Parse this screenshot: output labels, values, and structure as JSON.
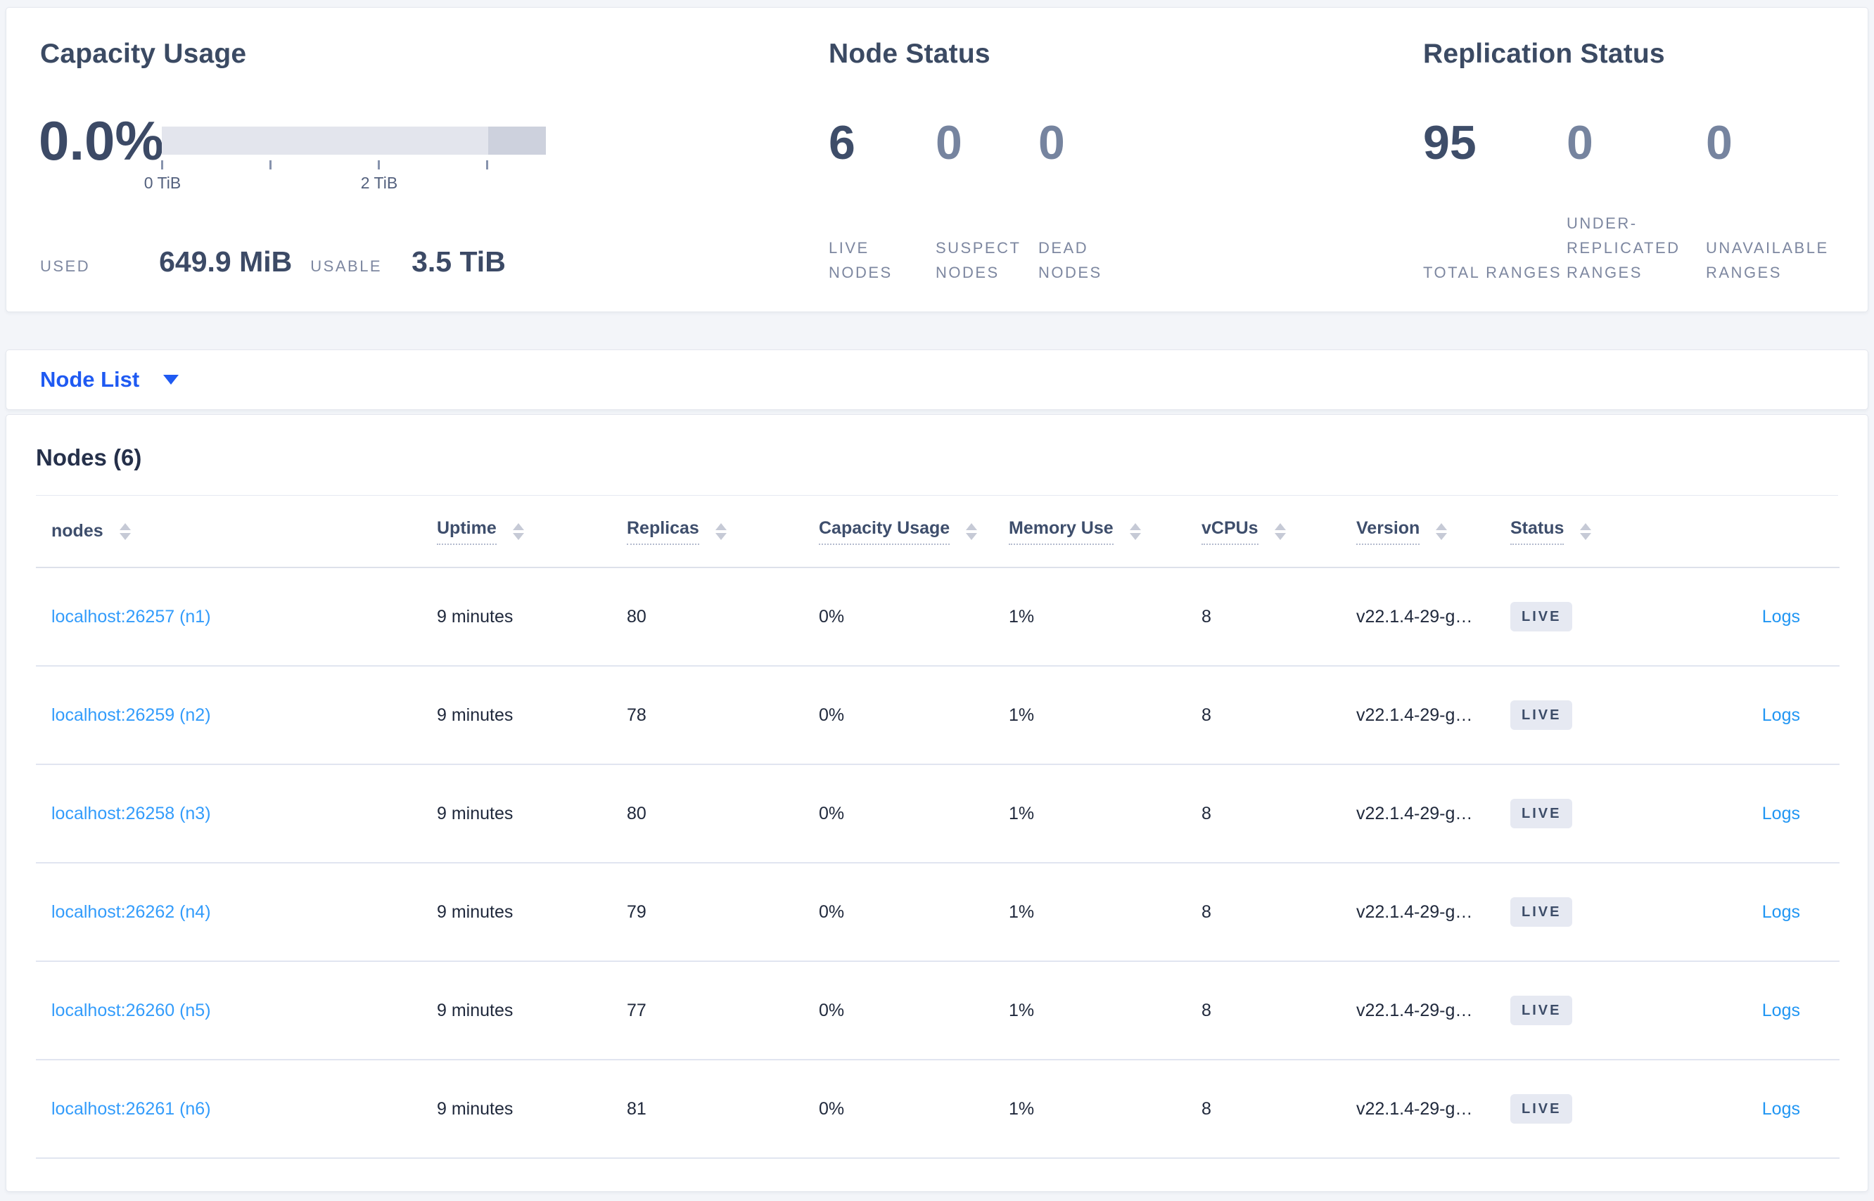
{
  "overview": {
    "capacity": {
      "title": "Capacity Usage",
      "percent": "0.0%",
      "axis_ticks": [
        "0 TiB",
        "2 TiB"
      ],
      "bar_dark_pct": 15,
      "used_label": "USED",
      "used_value": "649.9 MiB",
      "usable_label": "USABLE",
      "usable_value": "3.5 TiB"
    },
    "node_status": {
      "title": "Node Status",
      "stats": [
        {
          "value": "6",
          "label": "LIVE NODES"
        },
        {
          "value": "0",
          "label": "SUSPECT NODES"
        },
        {
          "value": "0",
          "label": "DEAD NODES"
        }
      ]
    },
    "replication_status": {
      "title": "Replication Status",
      "stats": [
        {
          "value": "95",
          "label": "TOTAL RANGES"
        },
        {
          "value": "0",
          "label": "UNDER-REPLICATED RANGES"
        },
        {
          "value": "0",
          "label": "UNAVAILABLE RANGES"
        }
      ]
    }
  },
  "view_selector": {
    "label": "Node List",
    "icon": "caret-down-icon"
  },
  "nodes_table": {
    "heading": "Nodes (6)",
    "columns": [
      {
        "label": "nodes"
      },
      {
        "label": "Uptime"
      },
      {
        "label": "Replicas"
      },
      {
        "label": "Capacity Usage"
      },
      {
        "label": "Memory Use"
      },
      {
        "label": "vCPUs"
      },
      {
        "label": "Version"
      },
      {
        "label": "Status"
      }
    ],
    "rows": [
      {
        "node": "localhost:26257 (n1)",
        "uptime": "9 minutes",
        "replicas": "80",
        "capacity": "0%",
        "memory": "1%",
        "vcpus": "8",
        "version": "v22.1.4-29-g…",
        "status": "LIVE",
        "logs": "Logs"
      },
      {
        "node": "localhost:26259 (n2)",
        "uptime": "9 minutes",
        "replicas": "78",
        "capacity": "0%",
        "memory": "1%",
        "vcpus": "8",
        "version": "v22.1.4-29-g…",
        "status": "LIVE",
        "logs": "Logs"
      },
      {
        "node": "localhost:26258 (n3)",
        "uptime": "9 minutes",
        "replicas": "80",
        "capacity": "0%",
        "memory": "1%",
        "vcpus": "8",
        "version": "v22.1.4-29-g…",
        "status": "LIVE",
        "logs": "Logs"
      },
      {
        "node": "localhost:26262 (n4)",
        "uptime": "9 minutes",
        "replicas": "79",
        "capacity": "0%",
        "memory": "1%",
        "vcpus": "8",
        "version": "v22.1.4-29-g…",
        "status": "LIVE",
        "logs": "Logs"
      },
      {
        "node": "localhost:26260 (n5)",
        "uptime": "9 minutes",
        "replicas": "77",
        "capacity": "0%",
        "memory": "1%",
        "vcpus": "8",
        "version": "v22.1.4-29-g…",
        "status": "LIVE",
        "logs": "Logs"
      },
      {
        "node": "localhost:26261 (n6)",
        "uptime": "9 minutes",
        "replicas": "81",
        "capacity": "0%",
        "memory": "1%",
        "vcpus": "8",
        "version": "v22.1.4-29-g…",
        "status": "LIVE",
        "logs": "Logs"
      }
    ]
  },
  "colors": {
    "page_bg": "#f3f5f9",
    "card_bg": "#ffffff",
    "accent_blue": "#1f5af2",
    "node_link_blue": "#339cfb",
    "logs_link_blue": "#2196f3",
    "stat_dark": "#3e4d69",
    "stat_muted": "#76849f",
    "badge_bg": "#e6e9f2",
    "bar_light": "#e3e5ed",
    "bar_dark": "#cdd1dd"
  }
}
